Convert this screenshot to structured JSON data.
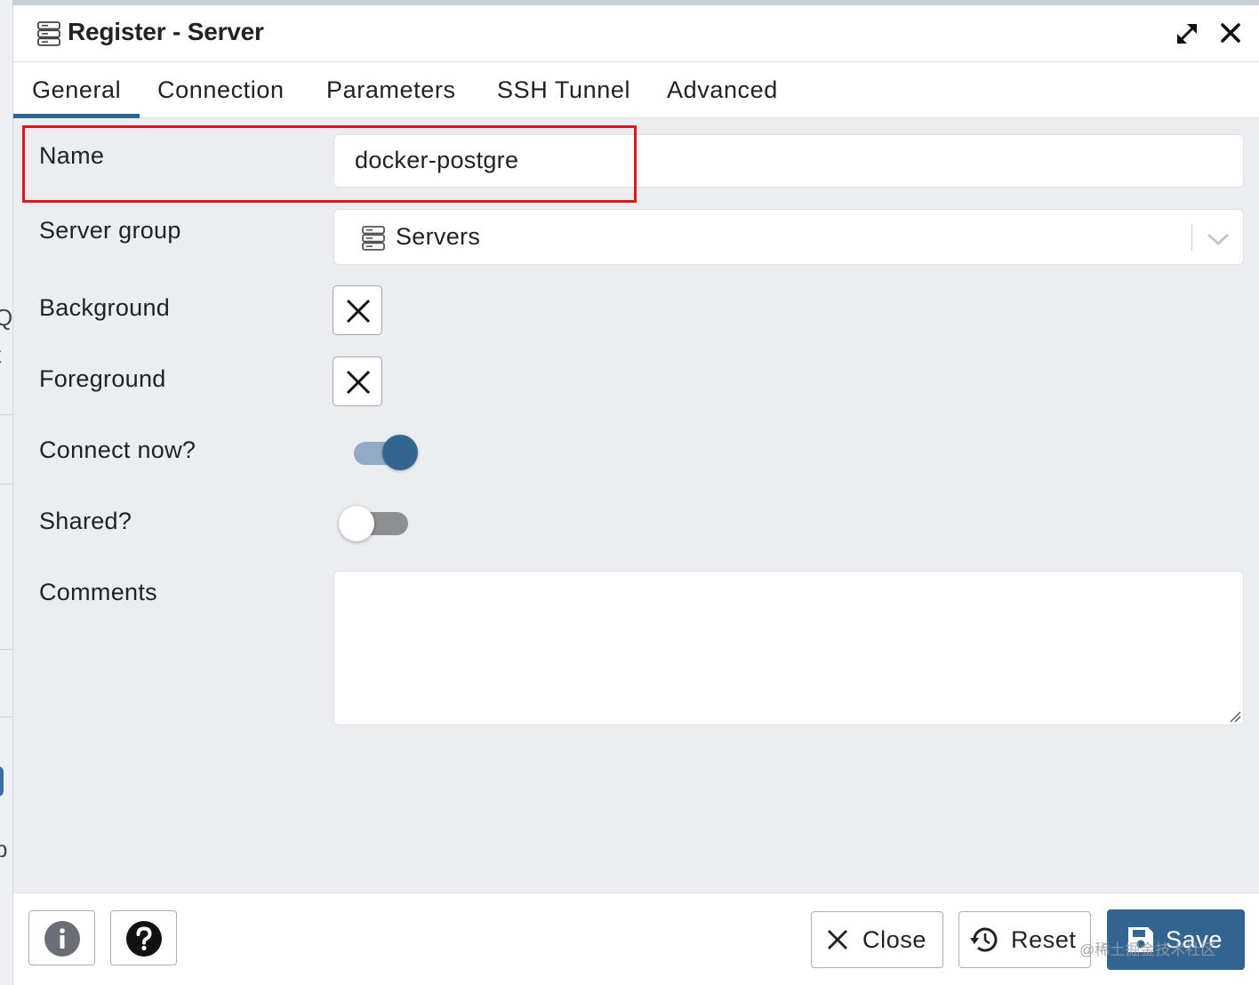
{
  "window": {
    "title": "Register - Server"
  },
  "tabs": [
    {
      "label": "General",
      "active": true
    },
    {
      "label": "Connection",
      "active": false
    },
    {
      "label": "Parameters",
      "active": false
    },
    {
      "label": "SSH Tunnel",
      "active": false
    },
    {
      "label": "Advanced",
      "active": false
    }
  ],
  "form": {
    "name": {
      "label": "Name",
      "value": "docker-postgre"
    },
    "server_group": {
      "label": "Server group",
      "value": "Servers"
    },
    "background": {
      "label": "Background"
    },
    "foreground": {
      "label": "Foreground"
    },
    "connect_now": {
      "label": "Connect now?",
      "checked": true
    },
    "shared": {
      "label": "Shared?",
      "checked": false
    },
    "comments": {
      "label": "Comments",
      "value": ""
    }
  },
  "footer": {
    "close_label": "Close",
    "reset_label": "Reset",
    "save_label": "Save"
  },
  "background_fragments": [
    "Q",
    "t",
    "b"
  ],
  "watermark": "@稀土掘金技术社区",
  "colors": {
    "accent": "#326690",
    "highlight": "#e0161c",
    "panel": "#ebedf1"
  },
  "icons": [
    "server-icon",
    "maximize-icon",
    "close-icon",
    "servers-icon",
    "chevron-down-icon",
    "x-icon",
    "info-icon",
    "help-icon",
    "reset-icon",
    "save-icon"
  ]
}
